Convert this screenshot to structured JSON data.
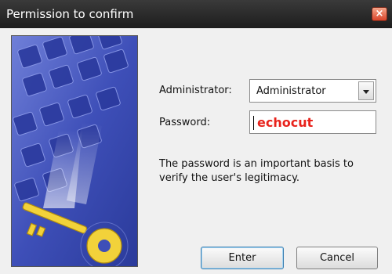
{
  "window": {
    "title": "Permission to confirm",
    "close_glyph": "×"
  },
  "side_image": {
    "description_icon": "keyboard-key-icon"
  },
  "form": {
    "administrator_label": "Administrator:",
    "administrator_value": "Administrator",
    "password_label": "Password:",
    "password_value": "echocut"
  },
  "info_text": "The password is an important basis to verify the user's legitimacy.",
  "buttons": {
    "enter_label": "Enter",
    "cancel_label": "Cancel"
  },
  "colors": {
    "password_text": "#e8231c",
    "titlebar": "#1d1d1d"
  }
}
